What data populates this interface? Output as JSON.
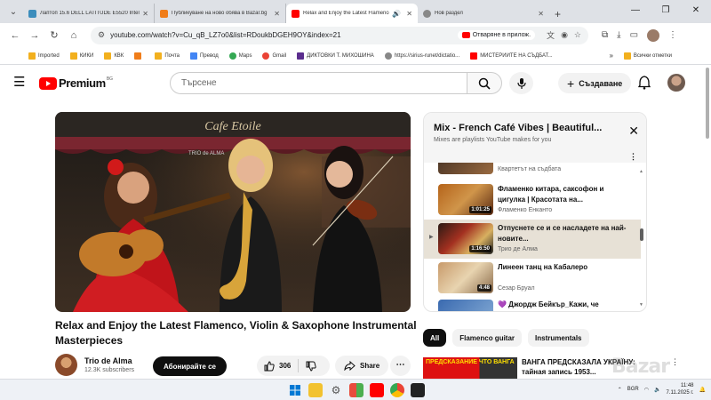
{
  "browser": {
    "tabs": [
      {
        "title": "Лаптоп 15.6 DELL LATITUDE E5520 Intel C",
        "color": "#3c8dbc",
        "active": false
      },
      {
        "title": "Публикуване на ново обява в Bazar.bg",
        "color": "#f07d1a",
        "active": false
      },
      {
        "title": "Relax and Enjoy the Latest Flamenco",
        "color": "#ff0000",
        "active": true
      },
      {
        "title": "Нов раздел",
        "color": "#888888",
        "active": false
      }
    ],
    "url": "youtube.com/watch?v=Cu_qB_LZ7o0&list=RDoukbDGEH9OY&index=21",
    "open_in_app": "Отваряне в прилож.",
    "bookmarks": [
      {
        "label": "Imported",
        "color": "#f2b01e"
      },
      {
        "label": "КИКИ",
        "color": "#f2b01e"
      },
      {
        "label": "КВК",
        "color": "#f2b01e"
      },
      {
        "label": "",
        "color": "#f07d1a"
      },
      {
        "label": "Почта",
        "color": "#f2b01e"
      },
      {
        "label": "Превод",
        "color": "#4285f4"
      },
      {
        "label": "Maps",
        "color": "#34a853"
      },
      {
        "label": "Gmail",
        "color": "#ea4335"
      },
      {
        "label": "ДИКТОВКИ Т. МИХОШИНА",
        "color": "#5b2d8e"
      },
      {
        "label": "https://sirius-runet/dictatio...",
        "color": "#888888"
      },
      {
        "label": "МИСТЕРИИТЕ НА СЪДБАТ...",
        "color": "#ff0000"
      }
    ],
    "all_bookmarks": "Всички отметки"
  },
  "youtube": {
    "logo_text": "Premium",
    "logo_country": "BG",
    "search_placeholder": "Търсене",
    "create_label": "Създаване"
  },
  "video": {
    "title": "Relax and Enjoy the Latest Flamenco, Violin & Saxophone Instrumental Masterpieces",
    "channel": "Trio de Alma",
    "subscribers": "12.3K subscribers",
    "subscribe_label": "Абонирайте се",
    "likes": "306",
    "share_label": "Share",
    "overlay_sign": "Cafe Etoile",
    "overlay_brand": "TRIO de ALMA"
  },
  "mix": {
    "title": "Mix - French Café Vibes | Beautiful...",
    "subtitle": "Mixes are playlists YouTube makes for you",
    "items": [
      {
        "title": "",
        "channel": "Квартетът на съдбата",
        "duration": "",
        "current": false
      },
      {
        "title": "Фламенко китара, саксофон и цигулка | Красотата на...",
        "channel": "Фламенко Енканто",
        "duration": "1:01:25",
        "current": false
      },
      {
        "title": "Отпуснете се и се насладете на най-новите...",
        "channel": "Трио де Алма",
        "duration": "1:16:50",
        "current": true
      },
      {
        "title": "Линеен танц на Кабалеро",
        "channel": "Сезар Бруал",
        "duration": "4:48",
        "current": false
      },
      {
        "title": "💜 Джордж Бейкър_Кажи, че",
        "channel": "",
        "duration": "",
        "current": false
      }
    ]
  },
  "chips": [
    "All",
    "Flamenco guitar",
    "Instrumentals"
  ],
  "recommendation": {
    "thumb_text": "ПРЕДСКАЗАНИЕ ЧТО ВАНГА",
    "title": "ВАНГА ПРЕДСКАЗАЛА УКРАЇНУ: тайная запись 1953..."
  },
  "taskbar": {
    "lang": "BGR",
    "time": "11:48",
    "date": "7.11.2025 г."
  },
  "watermark": "Bazar"
}
